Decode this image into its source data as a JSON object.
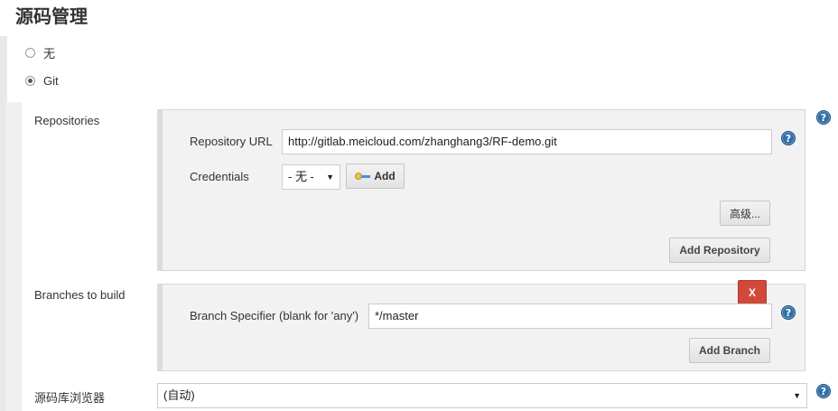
{
  "section": {
    "title": "源码管理"
  },
  "scm_options": [
    {
      "label": "无",
      "checked": false
    },
    {
      "label": "Git",
      "checked": true
    }
  ],
  "repositories": {
    "label": "Repositories",
    "url_label": "Repository URL",
    "url_value": "http://gitlab.meicloud.com/zhanghang3/RF-demo.git",
    "credentials_label": "Credentials",
    "credentials_value": "- 无 -",
    "add_label": "Add",
    "advanced_label": "高级...",
    "add_repository_label": "Add Repository"
  },
  "branches": {
    "label": "Branches to build",
    "delete_label": "X",
    "specifier_label": "Branch Specifier (blank for 'any')",
    "specifier_value": "*/master",
    "add_branch_label": "Add Branch"
  },
  "browser": {
    "label": "源码库浏览器",
    "value": "(自动)"
  },
  "icons": {
    "help": "help-icon",
    "key": "key-icon",
    "dropdown": "chevron-down-icon"
  },
  "colors": {
    "delete": "#d24939",
    "help": "#2f6fa8"
  }
}
